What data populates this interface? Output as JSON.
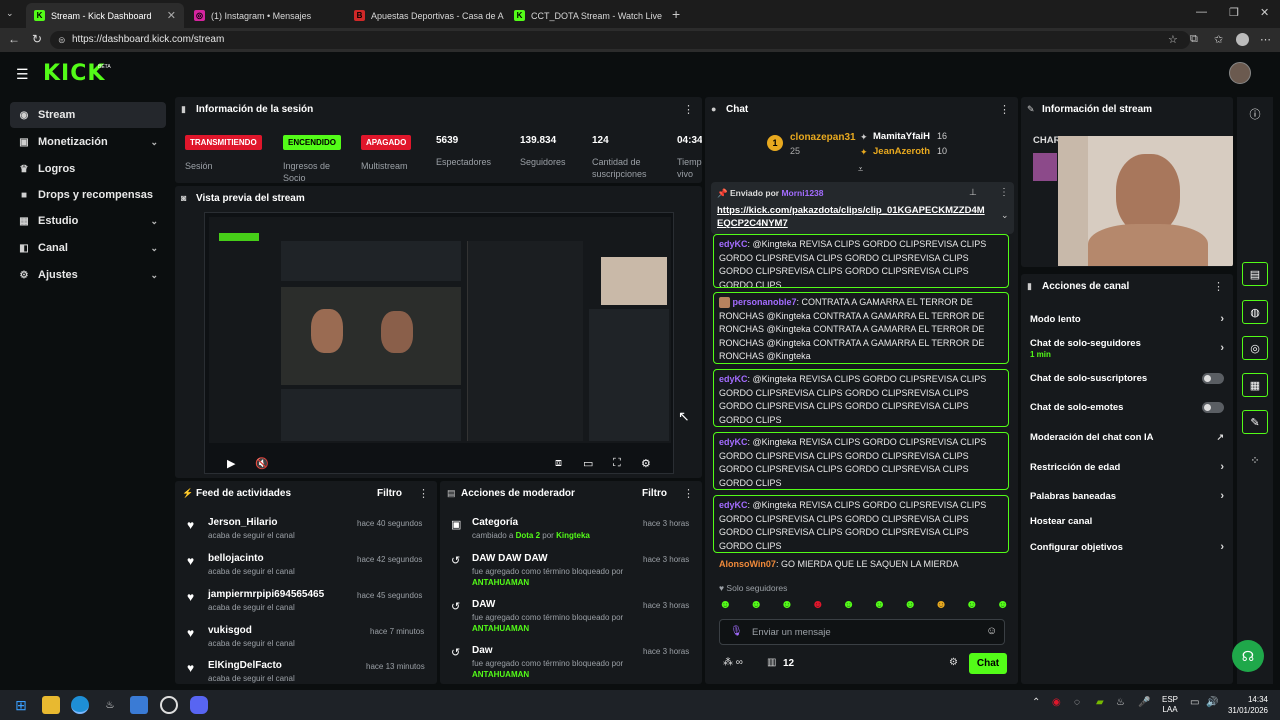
{
  "browser": {
    "tabs": [
      {
        "title": "Stream - Kick Dashboard",
        "active": true
      },
      {
        "title": "(1) Instagram • Mensajes",
        "active": false
      },
      {
        "title": "Apuestas Deportivas - Casa de Ap",
        "active": false
      },
      {
        "title": "CCT_DOTA Stream - Watch Live on",
        "active": false
      }
    ],
    "url": "https://dashboard.kick.com/stream"
  },
  "brand": {
    "logo": "KICK",
    "beta": "BETA",
    "accent": "#53fc18"
  },
  "sidebar": {
    "items": [
      {
        "label": "Stream",
        "icon": "broadcast-icon",
        "active": true
      },
      {
        "label": "Monetización",
        "icon": "money-icon",
        "chevron": true
      },
      {
        "label": "Logros",
        "icon": "trophy-icon"
      },
      {
        "label": "Drops y recompensas",
        "icon": "gift-icon"
      },
      {
        "label": "Estudio",
        "icon": "studio-icon",
        "chevron": true
      },
      {
        "label": "Canal",
        "icon": "channel-icon",
        "chevron": true
      },
      {
        "label": "Ajustes",
        "icon": "gear-icon",
        "chevron": true
      }
    ]
  },
  "session": {
    "title": "Información de la sesión",
    "stats": [
      {
        "badge": "TRANSMITIENDO",
        "label": "Sesión",
        "color": "#e0162b"
      },
      {
        "badge": "ENCENDIDO",
        "label": "Ingresos de Socio",
        "color": "#53fc18"
      },
      {
        "badge": "APAGADO",
        "label": "Multistream",
        "color": "#e0162b"
      },
      {
        "value": "5639",
        "label": "Espectadores"
      },
      {
        "value": "139.834",
        "label": "Seguidores"
      },
      {
        "value": "124",
        "label": "Cantidad de suscripciones"
      },
      {
        "value": "04:34",
        "label": "Tiempo en vivo"
      }
    ]
  },
  "preview": {
    "title": "Vista previa del stream"
  },
  "activity": {
    "title": "Feed de actividades",
    "filter": "Filtro",
    "items": [
      {
        "name": "Jerson_Hilario",
        "action": "acaba de seguir el canal",
        "time": "hace 40 segundos"
      },
      {
        "name": "bellojacinto",
        "action": "acaba de seguir el canal",
        "time": "hace 42 segundos"
      },
      {
        "name": "jampiermrpipi694565465",
        "action": "acaba de seguir el canal",
        "time": "hace 45 segundos"
      },
      {
        "name": "vukisgod",
        "action": "acaba de seguir el canal",
        "time": "hace 7 minutos"
      },
      {
        "name": "ElKingDelFacto",
        "action": "acaba de seguir el canal",
        "time": "hace 13 minutos"
      }
    ]
  },
  "modactions": {
    "title": "Acciones de moderador",
    "filter": "Filtro",
    "items": [
      {
        "title": "Categoría",
        "line1": "cambiado a",
        "target": "Dota 2",
        "mid": "por",
        "by": "Kingteka",
        "time": "hace 3 horas"
      },
      {
        "title": "DAW DAW DAW",
        "line1": "fue agregado como término bloqueado por",
        "by": "ANTAHUAMAN",
        "time": "hace 3 horas"
      },
      {
        "title": "DAW",
        "line1": "fue agregado como término bloqueado por",
        "by": "ANTAHUAMAN",
        "time": "hace 3 horas"
      },
      {
        "title": "Daw",
        "line1": "fue agregado como término bloqueado por",
        "by": "ANTAHUAMAN",
        "time": "hace 3 horas"
      }
    ]
  },
  "chat": {
    "title": "Chat",
    "leaders": [
      {
        "name": "clonazepan31",
        "count": "25"
      },
      {
        "name": "MamitaYfaiH",
        "count": "16"
      },
      {
        "name": "JeanAzeroth",
        "count": "10"
      }
    ],
    "pinned": {
      "label": "Enviado por",
      "by": "Morni1238",
      "link": "https://kick.com/pakazdota/clips/clip_01KGAPECKMZZD4MEQCP2C4NYM7"
    },
    "messages": [
      {
        "user": "edyKC",
        "text": "@Kingteka REVISA CLIPS GORDO CLIPSREVISA CLIPS GORDO CLIPSREVISA CLIPS GORDO CLIPSREVISA CLIPS GORDO CLIPSREVISA CLIPS GORDO CLIPSREVISA CLIPS GORDO CLIPS"
      },
      {
        "user": "personanoble7",
        "text": "CONTRATA A GAMARRA EL TERROR DE RONCHAS @Kingteka CONTRATA A GAMARRA EL TERROR DE RONCHAS @Kingteka CONTRATA A GAMARRA EL TERROR DE RONCHAS @Kingteka CONTRATA A GAMARRA EL TERROR DE RONCHAS @Kingteka"
      },
      {
        "user": "edyKC",
        "text": "@Kingteka REVISA CLIPS GORDO CLIPSREVISA CLIPS GORDO CLIPSREVISA CLIPS GORDO CLIPSREVISA CLIPS GORDO CLIPSREVISA CLIPS GORDO CLIPSREVISA CLIPS GORDO CLIPS"
      },
      {
        "user": "edyKC",
        "text": "@Kingteka REVISA CLIPS GORDO CLIPSREVISA CLIPS GORDO CLIPSREVISA CLIPS GORDO CLIPSREVISA CLIPS GORDO CLIPSREVISA CLIPS GORDO CLIPSREVISA CLIPS GORDO CLIPS"
      },
      {
        "user": "edyKC",
        "text": "@Kingteka REVISA CLIPS GORDO CLIPSREVISA CLIPS GORDO CLIPSREVISA CLIPS GORDO CLIPSREVISA CLIPS GORDO CLIPSREVISA CLIPS GORDO CLIPSREVISA CLIPS GORDO CLIPS"
      }
    ],
    "plain": {
      "user": "AlonsoWin07",
      "text": "GO MIERDA QUE LE SAQUEN LA MIERDA"
    },
    "mode": "Solo seguidores",
    "placeholder": "Enviar un mensaje",
    "viewers": "12",
    "send": "Chat"
  },
  "streaminfo": {
    "title": "Información del stream",
    "stream_title": "CHARLANDO CON LOS AMIGOS"
  },
  "channelactions": {
    "title": "Acciones de canal",
    "rows": [
      {
        "label": "Modo lento",
        "type": "chevron"
      },
      {
        "label": "Chat de solo-seguidores",
        "sub": "1 min",
        "type": "chevron"
      },
      {
        "label": "Chat de solo-suscriptores",
        "type": "toggle"
      },
      {
        "label": "Chat de solo-emotes",
        "type": "toggle"
      },
      {
        "label": "Moderación del chat con IA",
        "type": "external"
      },
      {
        "label": "Restricción de edad",
        "type": "chevron"
      },
      {
        "label": "Palabras baneadas",
        "type": "chevron"
      },
      {
        "label": "Hostear canal",
        "type": "none"
      },
      {
        "label": "Configurar objetivos",
        "type": "chevron"
      }
    ]
  },
  "taskbar": {
    "lang": "ESP",
    "layout": "LAA",
    "time": "14:34",
    "date": "31/01/2026"
  }
}
